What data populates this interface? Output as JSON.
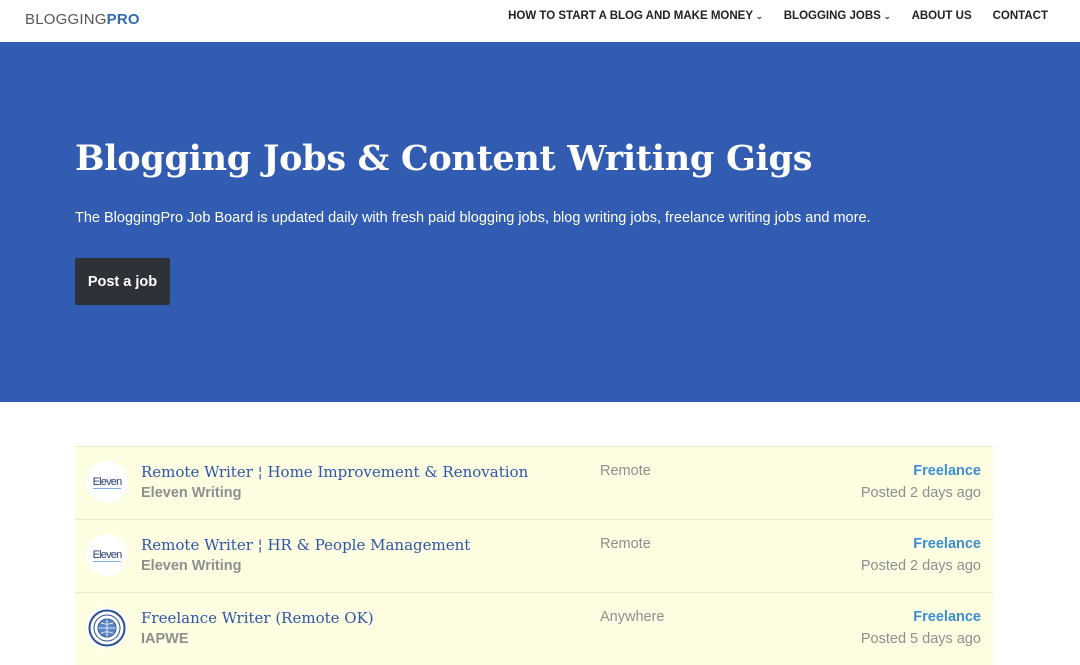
{
  "brand": {
    "logo_part1": "BLOGGING",
    "logo_part2": "PRO"
  },
  "nav": {
    "items": [
      {
        "label": "HOW TO START A BLOG AND MAKE MONEY",
        "caret": "⌄"
      },
      {
        "label": "BLOGGING JOBS",
        "caret": "⌄"
      },
      {
        "label": "ABOUT US",
        "caret": ""
      },
      {
        "label": "CONTACT",
        "caret": ""
      }
    ]
  },
  "hero": {
    "title": "Blogging Jobs & Content Writing Gigs",
    "subtitle": "The BloggingPro Job Board is updated daily with fresh paid blogging jobs, blog writing jobs, freelance writing jobs and more.",
    "post_button": "Post a job",
    "bg_color": "#315cb1"
  },
  "jobs": [
    {
      "logo": "Eleven",
      "title": "Remote Writer ¦ Home Improvement & Renovation",
      "company": "Eleven Writing",
      "location": "Remote",
      "type": "Freelance",
      "posted": "Posted 2 days ago"
    },
    {
      "logo": "Eleven",
      "title": "Remote Writer ¦ HR & People Management",
      "company": "Eleven Writing",
      "location": "Remote",
      "type": "Freelance",
      "posted": "Posted 2 days ago"
    },
    {
      "logo": "",
      "title": "Freelance Writer (Remote OK)",
      "company": "IAPWE",
      "location": "Anywhere",
      "type": "Freelance",
      "posted": "Posted 5 days ago"
    }
  ]
}
